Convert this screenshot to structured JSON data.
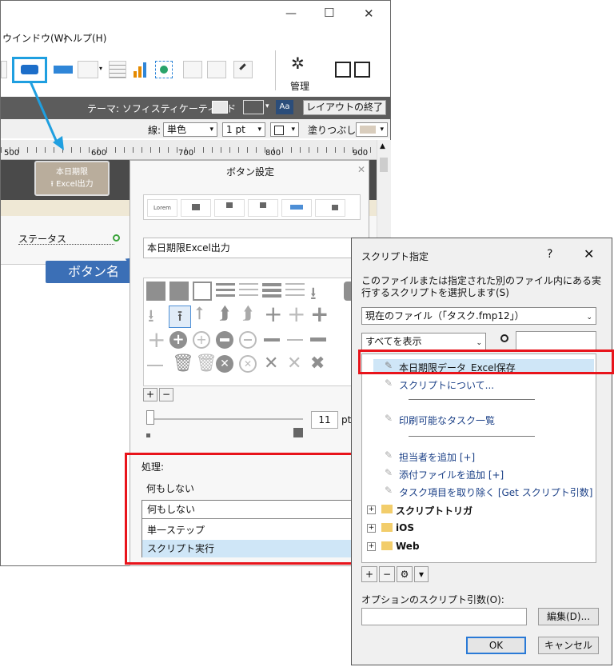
{
  "main_window": {
    "controls": {
      "minimize": "—",
      "maximize": "☐",
      "close": "✕"
    },
    "menu": [
      "ウインドウ(W)",
      "ヘルプ(H)"
    ],
    "manage_label": "管理",
    "theme_label": "テーマ: ソフィスティケーティッド",
    "exit_layout_label": "レイアウトの終了",
    "line_label": "線:",
    "line_style": "単色",
    "line_width": "1 pt",
    "fill_label": "塗りつぶし:",
    "ruler_marks": [
      "500",
      "600",
      "700",
      "800",
      "900"
    ],
    "layout_button": {
      "line1": "本日期限",
      "line2": "Excel出力"
    },
    "status_label": "ステータス",
    "callout": "ボタン名"
  },
  "button_settings": {
    "title": "ボタン設定",
    "styles_sample": [
      "Lorem",
      "",
      "Lorem",
      "Lorem",
      "Lorem",
      "Lorem"
    ],
    "name_value": "本日期限Excel出力",
    "size_value": "11",
    "size_unit": "pt",
    "plus": "+",
    "minus": "−",
    "action_label": "処理:",
    "action_selected": "何もしない",
    "action_options": [
      "何もしない",
      "単一ステップ",
      "スクリプト実行"
    ]
  },
  "script_dialog": {
    "title": "スクリプト指定",
    "help": "?",
    "close": "✕",
    "description": "このファイルまたは指定された別のファイル内にある実行するスクリプトを選択します(S)",
    "file_select": "現在のファイル（「タスク.fmp12」）",
    "filter_select": "すべてを表示",
    "search_value": "",
    "scripts": [
      {
        "label": "本日期限データ_Excel保存",
        "selected": true
      },
      {
        "label": "スクリプトについて..."
      },
      {
        "separator": true
      },
      {
        "label": "印刷可能なタスク一覧"
      },
      {
        "separator": true
      },
      {
        "label": "担当者を追加 [+]"
      },
      {
        "label": "添付ファイルを追加 [+]"
      },
      {
        "label": "タスク項目を取り除く [Get スクリプト引数]"
      }
    ],
    "folders": [
      "スクリプトトリガ",
      "iOS",
      "Web"
    ],
    "bottom_tools": [
      "+",
      "−",
      "⚙",
      "▾"
    ],
    "param_label": "オプションのスクリプト引数(O):",
    "param_value": "",
    "edit_button": "編集(D)...",
    "ok_button": "OK",
    "cancel_button": "キャンセル"
  },
  "colors": {
    "highlight_red": "#e8141b",
    "callout_blue": "#1f9fe0",
    "callout_box": "#3b6fb6",
    "selection": "#cfe6f7"
  }
}
